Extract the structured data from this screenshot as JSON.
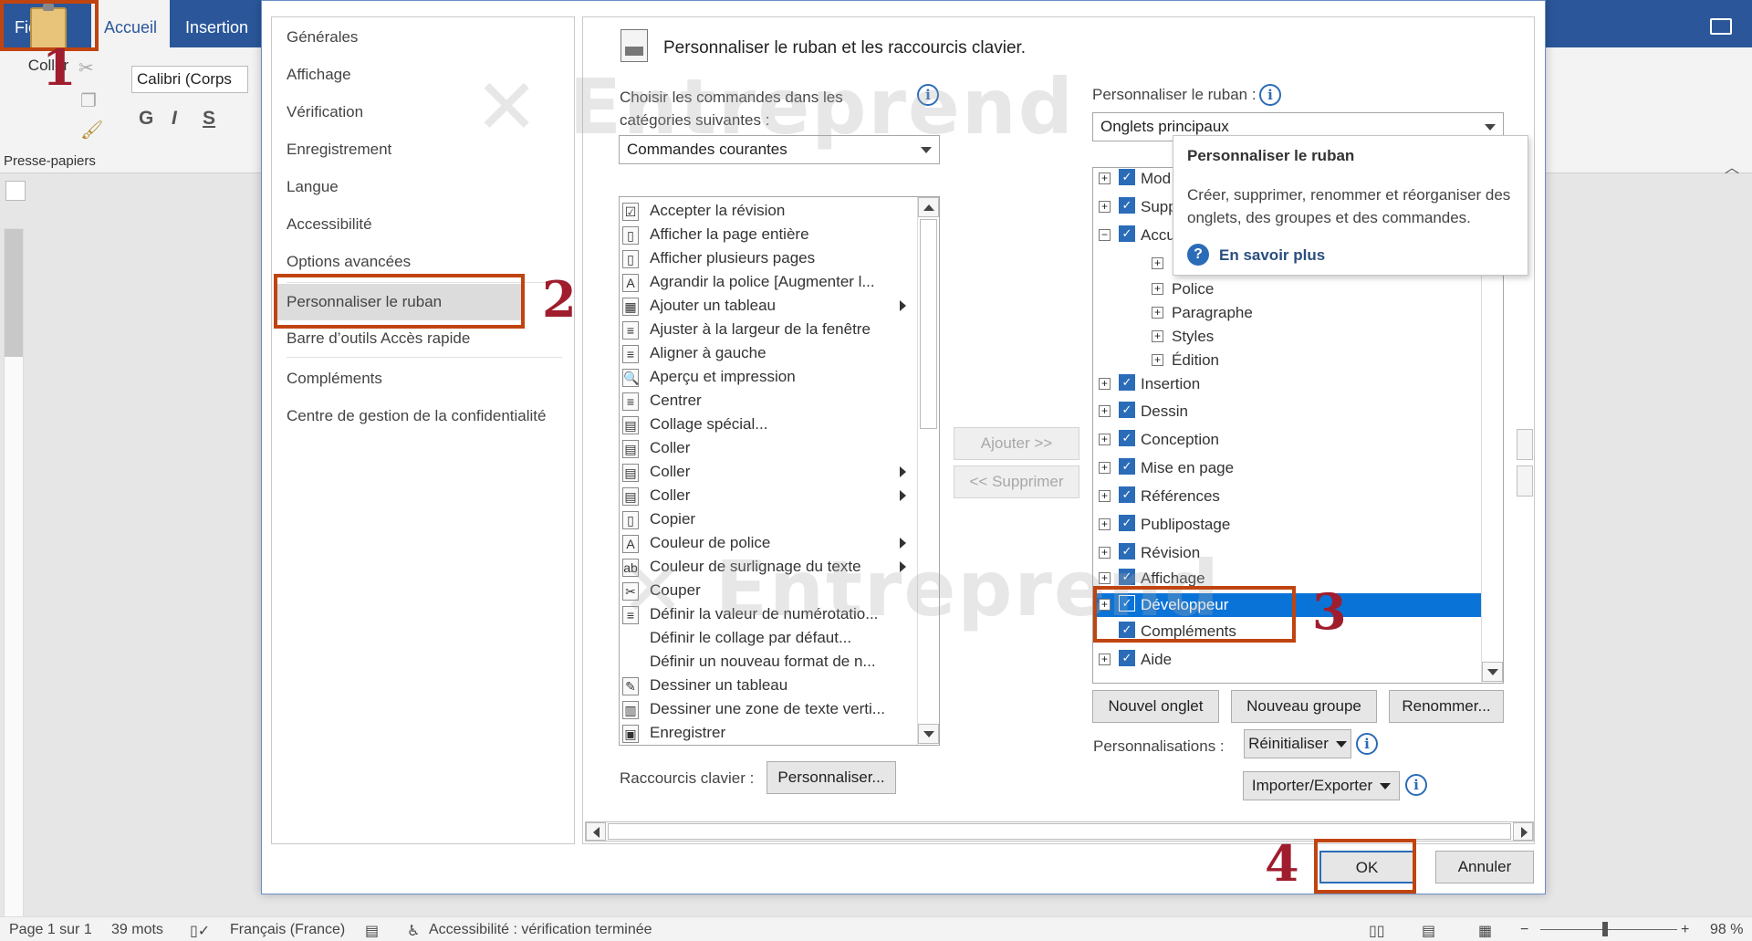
{
  "word": {
    "tabs": [
      "Fichier",
      "Accueil",
      "Insertion"
    ],
    "paste_label": "Coller",
    "font_name": "Calibri (Corps",
    "format_buttons": [
      "G",
      "I",
      "S"
    ],
    "clipboard_group": "Presse-papiers"
  },
  "status": {
    "page": "Page 1 sur 1",
    "words": "39 mots",
    "language": "Français (France)",
    "accessibility": "Accessibilité : vérification terminée",
    "zoom": "98 %"
  },
  "nav": {
    "items": [
      "Générales",
      "Affichage",
      "Vérification",
      "Enregistrement",
      "Langue",
      "Accessibilité",
      "Options avancées",
      "Personnaliser le ruban",
      "Barre d’outils Accès rapide",
      "Compléments",
      "Centre de gestion de la confidentialité"
    ],
    "selected_index": 7
  },
  "main": {
    "title": "Personnaliser le ruban et les raccourcis clavier.",
    "choose_label": "Choisir les commandes dans les catégories suivantes :",
    "choose_value": "Commandes courantes",
    "customize_label": "Personnaliser le ruban :",
    "customize_value": "Onglets principaux",
    "commands": [
      {
        "label": "Accepter la révision",
        "icon": "☑",
        "sub": false
      },
      {
        "label": "Afficher la page entière",
        "icon": "▯",
        "sub": false
      },
      {
        "label": "Afficher plusieurs pages",
        "icon": "▯",
        "sub": false
      },
      {
        "label": "Agrandir la police [Augmenter l...",
        "icon": "A",
        "sub": false
      },
      {
        "label": "Ajouter un tableau",
        "icon": "▦",
        "sub": true
      },
      {
        "label": "Ajuster à la largeur de la fenêtre",
        "icon": "≡",
        "sub": false
      },
      {
        "label": "Aligner à gauche",
        "icon": "≡",
        "sub": false
      },
      {
        "label": "Aperçu et impression",
        "icon": "🔍",
        "sub": false
      },
      {
        "label": "Centrer",
        "icon": "≡",
        "sub": false
      },
      {
        "label": "Collage spécial...",
        "icon": "▤",
        "sub": false
      },
      {
        "label": "Coller",
        "icon": "▤",
        "sub": false
      },
      {
        "label": "Coller",
        "icon": "▤",
        "sub": true
      },
      {
        "label": "Coller",
        "icon": "▤",
        "sub": true
      },
      {
        "label": "Copier",
        "icon": "▯",
        "sub": false
      },
      {
        "label": "Couleur de police",
        "icon": "A",
        "sub": true
      },
      {
        "label": "Couleur de surlignage du texte",
        "icon": "ab",
        "sub": true
      },
      {
        "label": "Couper",
        "icon": "✂",
        "sub": false
      },
      {
        "label": "Définir la valeur de numérotatio...",
        "icon": "≡",
        "sub": false
      },
      {
        "label": "Définir le collage par défaut...",
        "icon": "",
        "sub": false
      },
      {
        "label": "Définir un nouveau format de n...",
        "icon": "",
        "sub": false
      },
      {
        "label": "Dessiner un tableau",
        "icon": "✎",
        "sub": false
      },
      {
        "label": "Dessiner une zone de texte verti...",
        "icon": "▥",
        "sub": false
      },
      {
        "label": "Enregistrer",
        "icon": "▣",
        "sub": false
      }
    ],
    "add_button": "Ajouter >>",
    "remove_button": "<< Supprimer",
    "tree": [
      {
        "label": "Mod",
        "level": 0,
        "expand": "+"
      },
      {
        "label": "Supp",
        "level": 0,
        "expand": "+"
      },
      {
        "label": "Accu",
        "level": 0,
        "expand": "−"
      },
      {
        "label": "P",
        "level": 1,
        "expand": "+"
      },
      {
        "label": "Police",
        "level": 1,
        "expand": "+"
      },
      {
        "label": "Paragraphe",
        "level": 1,
        "expand": "+"
      },
      {
        "label": "Styles",
        "level": 1,
        "expand": "+"
      },
      {
        "label": "Édition",
        "level": 1,
        "expand": "+"
      },
      {
        "label": "Insertion",
        "level": 0,
        "expand": "+"
      },
      {
        "label": "Dessin",
        "level": 0,
        "expand": "+"
      },
      {
        "label": "Conception",
        "level": 0,
        "expand": "+"
      },
      {
        "label": "Mise en page",
        "level": 0,
        "expand": "+"
      },
      {
        "label": "Références",
        "level": 0,
        "expand": "+"
      },
      {
        "label": "Publipostage",
        "level": 0,
        "expand": "+"
      },
      {
        "label": "Révision",
        "level": 0,
        "expand": "+"
      },
      {
        "label": "Affichage",
        "level": 0,
        "expand": "+"
      },
      {
        "label": "Développeur",
        "level": 0,
        "expand": "+",
        "selected": true
      },
      {
        "label": "Compléments",
        "level": 0,
        "expand": ""
      },
      {
        "label": "Aide",
        "level": 0,
        "expand": "+"
      }
    ],
    "new_tab_button": "Nouvel onglet",
    "new_group_button": "Nouveau groupe",
    "rename_button": "Renommer...",
    "customizations_label": "Personnalisations :",
    "reset_button": "Réinitialiser",
    "import_export_button": "Importer/Exporter",
    "shortcuts_label": "Raccourcis clavier :",
    "customize_button": "Personnaliser...",
    "ok_button": "OK",
    "cancel_button": "Annuler"
  },
  "tooltip": {
    "title": "Personnaliser le ruban",
    "body": "Créer, supprimer, renommer et réorganiser des onglets, des groupes et des commandes.",
    "link": "En savoir plus"
  },
  "annotations": [
    "1",
    "2",
    "3",
    "4"
  ],
  "watermark": "Entreprend",
  "colors": {
    "word_blue": "#2b579a",
    "annotation": "#c0440f",
    "selection": "#0a73d8",
    "check_blue": "#2b6cb8"
  }
}
